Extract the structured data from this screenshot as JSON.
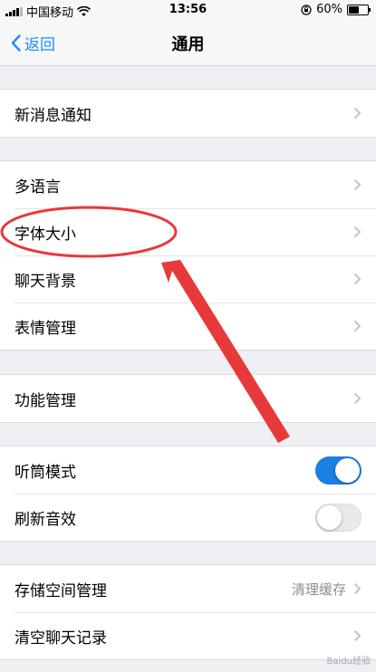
{
  "status_bar": {
    "carrier": "中国移动",
    "time": "13:56",
    "battery": "60%",
    "battery_level": 0.6
  },
  "nav": {
    "back_label": "返回",
    "title": "通用"
  },
  "groups": [
    {
      "rows": [
        {
          "label": "新消息通知"
        }
      ]
    },
    {
      "rows": [
        {
          "label": "多语言"
        },
        {
          "label": "字体大小"
        },
        {
          "label": "聊天背景"
        },
        {
          "label": "表情管理"
        }
      ]
    },
    {
      "rows": [
        {
          "label": "功能管理"
        }
      ]
    },
    {
      "rows": [
        {
          "label": "听筒模式",
          "toggle": true
        },
        {
          "label": "刷新音效",
          "toggle": false
        }
      ]
    },
    {
      "rows": [
        {
          "label": "存储空间管理",
          "value": "清理缓存"
        },
        {
          "label": "清空聊天记录"
        }
      ]
    }
  ],
  "colors": {
    "accent": "#1a8cff",
    "annotation": "#e8393a",
    "toggle_on": "#1a7fe0"
  },
  "watermark": "Baidu经验"
}
